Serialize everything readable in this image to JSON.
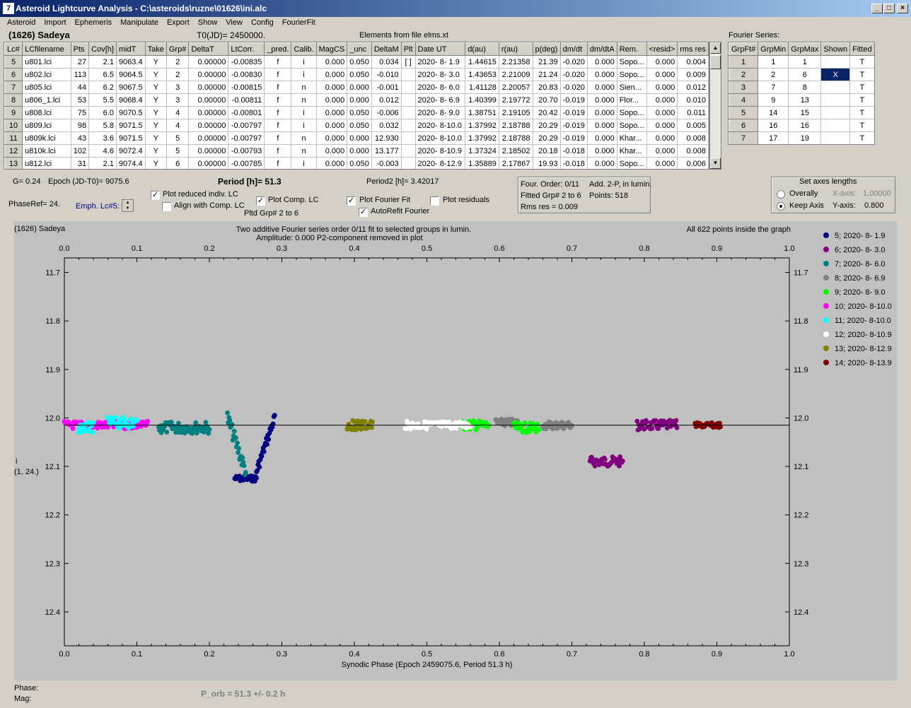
{
  "window": {
    "title": "Asteroid Lightcurve Analysis - C:\\asteroids\\ruzne\\01626\\ini.alc",
    "icon": "app-icon"
  },
  "menu": [
    "Asteroid",
    "Import",
    "Ephemeris",
    "Manipulate",
    "Export",
    "Show",
    "View",
    "Config",
    "FourierFit"
  ],
  "header": {
    "asteroid": "(1626) Sadeya",
    "t0": "T0(JD)= 2450000.",
    "elements": "Elements from file elms.xt",
    "fourier_title": "Fourier Series:"
  },
  "lc_table": {
    "columns": [
      "Lc#",
      "LCfilename",
      "Pts",
      "Cov[h]",
      "midT",
      "Take",
      "Grp#",
      "DeltaT",
      "LtCorr.",
      "_pred.",
      "Calib.",
      "MagCS",
      "_unc",
      "DeltaM",
      "Plt",
      "Date UT",
      "d(au)",
      "r(au)",
      "p(deg)",
      "dm/dt",
      "dm/dtA",
      "Rem.",
      "<resid>",
      "rms res"
    ],
    "rows": [
      [
        "5",
        "u801.lci",
        "27",
        "2.1",
        "9063.4",
        "Y",
        "2",
        "0.00000",
        "-0.00835",
        "f",
        "i",
        "0.000",
        "0.050",
        "0.034",
        "[ ]",
        "2020- 8- 1.9",
        "1.44615",
        "2.21358",
        "21.39",
        "-0.020",
        "0.000",
        "Sopo...",
        "0.000",
        "0.004"
      ],
      [
        "6",
        "u802.lci",
        "113",
        "6.5",
        "9064.5",
        "Y",
        "2",
        "0.00000",
        "-0.00830",
        "f",
        "i",
        "0.000",
        "0.050",
        "-0.010",
        "",
        "2020- 8- 3.0",
        "1.43653",
        "2.21009",
        "21.24",
        "-0.020",
        "0.000",
        "Sopo...",
        "0.000",
        "0.009"
      ],
      [
        "7",
        "u805.lci",
        "44",
        "6.2",
        "9067.5",
        "Y",
        "3",
        "0.00000",
        "-0.00815",
        "f",
        "n",
        "0.000",
        "0.000",
        "-0.001",
        "",
        "2020- 8- 6.0",
        "1.41128",
        "2.20057",
        "20.83",
        "-0.020",
        "0.000",
        "Sien...",
        "0.000",
        "0.012"
      ],
      [
        "8",
        "u806_1.lci",
        "53",
        "5.5",
        "9068.4",
        "Y",
        "3",
        "0.00000",
        "-0.00811",
        "f",
        "n",
        "0.000",
        "0.000",
        "0.012",
        "",
        "2020- 8- 6.9",
        "1.40399",
        "2.19772",
        "20.70",
        "-0.019",
        "0.000",
        "Flor...",
        "0.000",
        "0.010"
      ],
      [
        "9",
        "u808.lci",
        "75",
        "6.0",
        "9070.5",
        "Y",
        "4",
        "0.00000",
        "-0.00801",
        "f",
        "i",
        "0.000",
        "0.050",
        "-0.006",
        "",
        "2020- 8- 9.0",
        "1.38751",
        "2.19105",
        "20.42",
        "-0.019",
        "0.000",
        "Sopo...",
        "0.000",
        "0.011"
      ],
      [
        "10",
        "u809.lci",
        "98",
        "5.8",
        "9071.5",
        "Y",
        "4",
        "0.00000",
        "-0.00797",
        "f",
        "i",
        "0.000",
        "0.050",
        "0.032",
        "",
        "2020- 8-10.0",
        "1.37992",
        "2.18788",
        "20.29",
        "-0.019",
        "0.000",
        "Sopo...",
        "0.000",
        "0.005"
      ],
      [
        "11",
        "u809k.lci",
        "43",
        "3.6",
        "9071.5",
        "Y",
        "5",
        "0.00000",
        "-0.00797",
        "f",
        "n",
        "0.000",
        "0.000",
        "12.930",
        "",
        "2020- 8-10.0",
        "1.37992",
        "2.18788",
        "20.29",
        "-0.019",
        "0.000",
        "Khar...",
        "0.000",
        "0.008"
      ],
      [
        "12",
        "u810k.lci",
        "102",
        "4.6",
        "9072.4",
        "Y",
        "5",
        "0.00000",
        "-0.00793",
        "f",
        "n",
        "0.000",
        "0.000",
        "13.177",
        "",
        "2020- 8-10.9",
        "1.37324",
        "2.18502",
        "20.18",
        "-0.018",
        "0.000",
        "Khar...",
        "0.000",
        "0.008"
      ],
      [
        "13",
        "u812.lci",
        "31",
        "2.1",
        "9074.4",
        "Y",
        "6",
        "0.00000",
        "-0.00785",
        "f",
        "i",
        "0.000",
        "0.050",
        "-0.003",
        "",
        "2020- 8-12.9",
        "1.35889",
        "2.17867",
        "19.93",
        "-0.018",
        "0.000",
        "Sopo...",
        "0.000",
        "0.006"
      ]
    ]
  },
  "fourier_table": {
    "columns": [
      "GrpFt#",
      "GrpMin",
      "GrpMax",
      "Shown",
      "Fitted"
    ],
    "rows": [
      [
        "1",
        "1",
        "1",
        "",
        "T"
      ],
      [
        "2",
        "2",
        "6",
        "X",
        "T"
      ],
      [
        "3",
        "7",
        "8",
        "",
        "T"
      ],
      [
        "4",
        "9",
        "13",
        "",
        "T"
      ],
      [
        "5",
        "14",
        "15",
        "",
        "T"
      ],
      [
        "6",
        "16",
        "16",
        "",
        "T"
      ],
      [
        "7",
        "17",
        "19",
        "",
        "T"
      ]
    ]
  },
  "params": {
    "g": "G= 0.24",
    "epoch": "Epoch (JD-T0)= 9075.6",
    "period": "Period [h]= 51.3",
    "period2": "Period2 [h]= 3.42017",
    "phaseref": "PhaseRef= 24.",
    "emph": "Emph. Lc#5:",
    "pltd_grp": "Pltd Grp#  2  to  6"
  },
  "checks": {
    "reduced": {
      "label": "Plot reduced indiv. LC",
      "checked": true
    },
    "align": {
      "label": "Align with Comp. LC",
      "checked": false
    },
    "comp": {
      "label": "Plot Comp. LC",
      "checked": true
    },
    "fourier": {
      "label": "Plot Fourier Fit",
      "checked": true
    },
    "autorefit": {
      "label": "AutoRefit Fourier",
      "checked": true
    },
    "residuals": {
      "label": "Plot residuals",
      "checked": false
    }
  },
  "info_box": {
    "l1a": "Four. Order:  0/11",
    "l1b": "Add. 2-P, in lumin.",
    "l2a": "Fitted Grp# 2 to 6",
    "l2b": "Points: 518",
    "l3": "Rms res      = 0.009"
  },
  "axes_box": {
    "title": "Set axes lengths",
    "overally": "Overally",
    "keep": "Keep Axis",
    "xaxis_label": "X-axis:",
    "xaxis_value": "1.00000",
    "yaxis_label": "Y-axis:",
    "yaxis_value": "0.800",
    "selected": "Keep Axis"
  },
  "status": {
    "phase": "Phase:",
    "mag": "Mag:",
    "porb": "P_orb = 51.3 +/- 0.2 h"
  },
  "chart_data": {
    "type": "scatter",
    "title": "(1626) Sadeya",
    "subtitle": [
      "Two additive Fourier series order 0/11 fit to selected groups in lumin.",
      "Amplitude: 0.000          P2-component removed in plot"
    ],
    "note": "All 622 points inside the graph",
    "xlabel": "Synodic Phase (Epoch 2459075.6, Period 51.3 h)",
    "ylabel": "i",
    "ylabel2": "(1, 24.)",
    "xlim": [
      0,
      1
    ],
    "ylim": [
      12.47,
      11.67
    ],
    "y_inverted": true,
    "xticks": [
      "0.0",
      "0.1",
      "0.2",
      "0.3",
      "0.4",
      "0.5",
      "0.6",
      "0.7",
      "0.8",
      "0.9",
      "1.0"
    ],
    "yticks": [
      "11.7",
      "11.8",
      "11.9",
      "12.0",
      "12.1",
      "12.2",
      "12.3",
      "12.4"
    ],
    "fit_line_y": 12.015,
    "background": "#c0c0c0",
    "series": [
      {
        "name": "5; 2020- 8- 1.9",
        "color": "#000080",
        "segments": [
          [
            0.235,
            0.265,
            12.125,
            0.006,
            "dip"
          ],
          [
            0.265,
            0.29,
            12.04,
            0.02,
            "rise"
          ]
        ]
      },
      {
        "name": "6; 2020- 8- 3.0",
        "color": "#800080",
        "segments": [
          [
            0.725,
            0.77,
            12.09,
            0.01,
            "dip"
          ],
          [
            0.79,
            0.845,
            12.015,
            0.01,
            "flat"
          ]
        ]
      },
      {
        "name": "7; 2020- 8- 6.0",
        "color": "#008080",
        "segments": [
          [
            0.13,
            0.2,
            12.02,
            0.012,
            "flat"
          ],
          [
            0.225,
            0.25,
            12.07,
            0.03,
            "fall"
          ]
        ]
      },
      {
        "name": "8; 2020- 8- 6.9",
        "color": "#808080",
        "segments": [
          [
            0.595,
            0.625,
            12.01,
            0.008,
            "flat"
          ],
          [
            0.66,
            0.7,
            12.015,
            0.008,
            "flat"
          ]
        ]
      },
      {
        "name": "9; 2020- 8- 9.0",
        "color": "#00ff00",
        "segments": [
          [
            0.545,
            0.585,
            12.015,
            0.01,
            "flat"
          ],
          [
            0.62,
            0.655,
            12.02,
            0.01,
            "flat"
          ]
        ]
      },
      {
        "name": "10; 2020- 8-10.0",
        "color": "#ff00ff",
        "segments": [
          [
            0.0,
            0.115,
            12.015,
            0.008,
            "flat"
          ]
        ]
      },
      {
        "name": "11; 2020- 8-10.0",
        "color": "#00ffff",
        "segments": [
          [
            0.02,
            0.04,
            12.02,
            0.01,
            "flat"
          ],
          [
            0.06,
            0.1,
            12.01,
            0.012,
            "flat"
          ]
        ]
      },
      {
        "name": "12; 2020- 8-10.9",
        "color": "#ffffff",
        "segments": [
          [
            0.47,
            0.56,
            12.015,
            0.008,
            "flat"
          ]
        ]
      },
      {
        "name": "13; 2020- 8-12.9",
        "color": "#808000",
        "segments": [
          [
            0.39,
            0.425,
            12.015,
            0.01,
            "flat"
          ]
        ]
      },
      {
        "name": "14; 2020- 8-13.9",
        "color": "#800000",
        "segments": [
          [
            0.87,
            0.905,
            12.015,
            0.005,
            "flat"
          ]
        ]
      }
    ]
  }
}
